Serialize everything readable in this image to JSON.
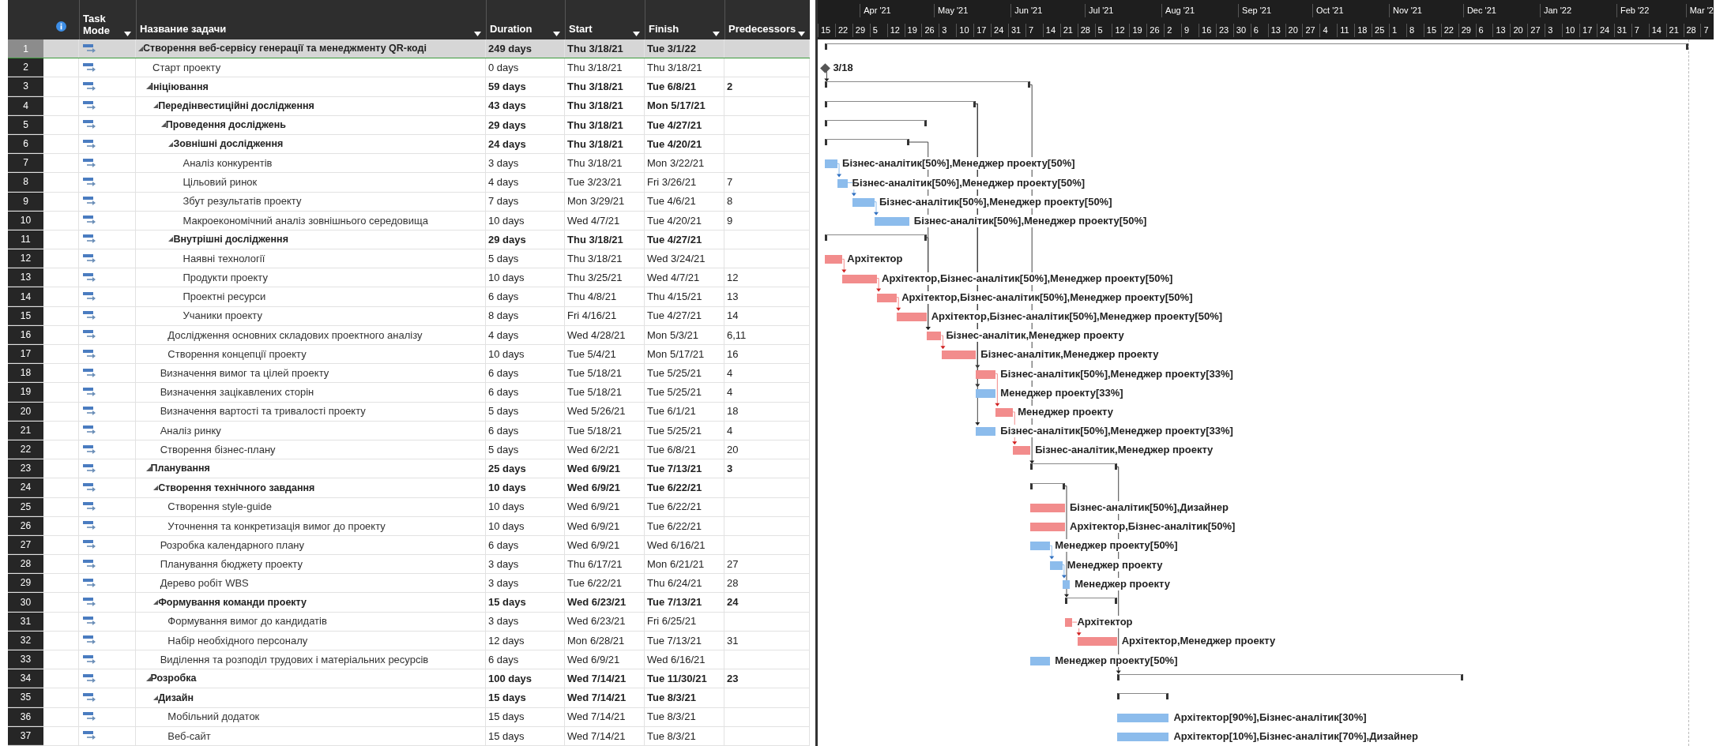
{
  "columns": [
    "Task Mode",
    "Название задачи",
    "Duration",
    "Start",
    "Finish",
    "Predecessors"
  ],
  "timescale": {
    "months": [
      "Apr '21",
      "May '21",
      "Jun '21",
      "Jul '21",
      "Aug '21",
      "Sep '21",
      "Oct '21",
      "Nov '21",
      "Dec '21",
      "Jan '22",
      "Feb '22",
      "Mar '2"
    ],
    "weeks": [
      "15",
      "22",
      "29",
      "5",
      "12",
      "19",
      "26",
      "3",
      "10",
      "17",
      "24",
      "31",
      "7",
      "14",
      "21",
      "28",
      "5",
      "12",
      "19",
      "26",
      "2",
      "9",
      "16",
      "23",
      "30",
      "6",
      "13",
      "20",
      "27",
      "4",
      "11",
      "18",
      "25",
      "1",
      "8",
      "15",
      "22",
      "29",
      "6",
      "13",
      "20",
      "27",
      "3",
      "10",
      "17",
      "24",
      "31",
      "7",
      "14",
      "21",
      "28",
      "7"
    ]
  },
  "tasks": [
    {
      "id": "1",
      "kind": "summary",
      "selected": true,
      "name": "Створення веб-сервісу генерації та менеджменту QR-коді",
      "duration": "249 days",
      "start": "Thu 3/18/21",
      "finish": "Tue 3/1/22",
      "children": [
        {
          "id": "2",
          "kind": "milestone",
          "selected": false,
          "name": "Старт проекту",
          "duration": "0 days",
          "start": "Thu 3/18/21",
          "finish": "Thu 3/18/21",
          "bar_label": "3/18"
        },
        {
          "id": "3",
          "kind": "summary",
          "selected": false,
          "name": "Ініціювання",
          "duration": "59 days",
          "start": "Thu 3/18/21",
          "finish": "Tue 6/8/21",
          "predecessors": "2",
          "children": [
            {
              "id": "4",
              "kind": "summary",
              "selected": false,
              "name": "Передінвестиційні дослідження",
              "duration": "43 days",
              "start": "Thu 3/18/21",
              "finish": "Mon 5/17/21",
              "children": [
                {
                  "id": "5",
                  "kind": "summary",
                  "selected": false,
                  "name": "Проведення досліджень",
                  "duration": "29 days",
                  "start": "Thu 3/18/21",
                  "finish": "Tue 4/27/21",
                  "children": [
                    {
                      "id": "6",
                      "kind": "summary",
                      "selected": false,
                      "name": "Зовнішні дослідження",
                      "duration": "24 days",
                      "start": "Thu 3/18/21",
                      "finish": "Tue 4/20/21",
                      "children": [
                        {
                          "id": "7",
                          "kind": "task",
                          "selected": false,
                          "name": "Аналіз конкурентів",
                          "duration": "3 days",
                          "start": "Thu 3/18/21",
                          "finish": "Mon 3/22/21",
                          "color": "#8cbcec",
                          "bar_label": "Бізнес-аналітик[50%],Менеджер проекту[50%]"
                        },
                        {
                          "id": "8",
                          "kind": "task",
                          "selected": false,
                          "name": "Цільовий ринок",
                          "duration": "4 days",
                          "start": "Tue 3/23/21",
                          "finish": "Fri 3/26/21",
                          "predecessors": "7",
                          "color": "#8cbcec",
                          "bar_label": "Бізнес-аналітик[50%],Менеджер проекту[50%]"
                        },
                        {
                          "id": "9",
                          "kind": "task",
                          "selected": false,
                          "name": "Збут результатів проекту",
                          "duration": "7 days",
                          "start": "Mon 3/29/21",
                          "finish": "Tue 4/6/21",
                          "predecessors": "8",
                          "color": "#8cbcec",
                          "bar_label": "Бізнес-аналітик[50%],Менеджер проекту[50%]"
                        },
                        {
                          "id": "10",
                          "kind": "task",
                          "selected": false,
                          "name": "Макроекономічний аналіз зовнішнього середовища",
                          "duration": "10 days",
                          "start": "Wed 4/7/21",
                          "finish": "Tue 4/20/21",
                          "predecessors": "9",
                          "color": "#8cbcec",
                          "bar_label": "Бізнес-аналітик[50%],Менеджер проекту[50%]"
                        }
                      ]
                    },
                    {
                      "id": "11",
                      "kind": "summary",
                      "selected": false,
                      "name": "Внутрішні дослідження",
                      "duration": "29 days",
                      "start": "Thu 3/18/21",
                      "finish": "Tue 4/27/21",
                      "children": [
                        {
                          "id": "12",
                          "kind": "task",
                          "selected": false,
                          "name": "Наявні технології",
                          "duration": "5 days",
                          "start": "Thu 3/18/21",
                          "finish": "Wed 3/24/21",
                          "color": "#f28c8c",
                          "bar_label": "Архітектор"
                        },
                        {
                          "id": "13",
                          "kind": "task",
                          "selected": false,
                          "name": "Продукти проекту",
                          "duration": "10 days",
                          "start": "Thu 3/25/21",
                          "finish": "Wed 4/7/21",
                          "predecessors": "12",
                          "color": "#f28c8c",
                          "bar_label": "Архітектор,Бізнес-аналітик[50%],Менеджер проекту[50%]"
                        },
                        {
                          "id": "14",
                          "kind": "task",
                          "selected": false,
                          "name": "Проектні ресурси",
                          "duration": "6 days",
                          "start": "Thu 4/8/21",
                          "finish": "Thu 4/15/21",
                          "predecessors": "13",
                          "color": "#f28c8c",
                          "bar_label": "Архітектор,Бізнес-аналітик[50%],Менеджер проекту[50%]"
                        },
                        {
                          "id": "15",
                          "kind": "task",
                          "selected": false,
                          "name": "Учаники проекту",
                          "duration": "8 days",
                          "start": "Fri 4/16/21",
                          "finish": "Tue 4/27/21",
                          "predecessors": "14",
                          "color": "#f28c8c",
                          "bar_label": "Архітектор,Бізнес-аналітик[50%],Менеджер проекту[50%]"
                        }
                      ]
                    }
                  ]
                },
                {
                  "id": "16",
                  "kind": "task",
                  "selected": false,
                  "name": "Дослідження основних складових проектного аналізу",
                  "duration": "4 days",
                  "start": "Wed 4/28/21",
                  "finish": "Mon 5/3/21",
                  "predecessors": "6,11",
                  "color": "#f28c8c",
                  "bar_label": "Бізнес-аналітик,Менеджер проекту"
                },
                {
                  "id": "17",
                  "kind": "task",
                  "selected": false,
                  "name": "Створення концепції проекту",
                  "duration": "10 days",
                  "start": "Tue 5/4/21",
                  "finish": "Mon 5/17/21",
                  "predecessors": "16",
                  "color": "#f28c8c",
                  "bar_label": "Бізнес-аналітик,Менеджер проекту"
                }
              ]
            },
            {
              "id": "18",
              "kind": "task",
              "selected": false,
              "name": "Визначення вимог та цілей проекту",
              "duration": "6 days",
              "start": "Tue 5/18/21",
              "finish": "Tue 5/25/21",
              "predecessors": "4",
              "color": "#f28c8c",
              "bar_label": "Бізнес-аналітик[50%],Менеджер проекту[33%]"
            },
            {
              "id": "19",
              "kind": "task",
              "selected": false,
              "name": "Визначення зацікавлених сторін",
              "duration": "6 days",
              "start": "Tue 5/18/21",
              "finish": "Tue 5/25/21",
              "predecessors": "4",
              "color": "#8cbcec",
              "bar_label": "Менеджер проекту[33%]"
            },
            {
              "id": "20",
              "kind": "task",
              "selected": false,
              "name": "Визначення вартості та тривалості проекту",
              "duration": "5 days",
              "start": "Wed 5/26/21",
              "finish": "Tue 6/1/21",
              "predecessors": "18",
              "color": "#f28c8c",
              "bar_label": "Менеджер проекту"
            },
            {
              "id": "21",
              "kind": "task",
              "selected": false,
              "name": "Аналіз ринку",
              "duration": "6 days",
              "start": "Tue 5/18/21",
              "finish": "Tue 5/25/21",
              "predecessors": "4",
              "color": "#8cbcec",
              "bar_label": "Бізнес-аналітик[50%],Менеджер проекту[33%]"
            },
            {
              "id": "22",
              "kind": "task",
              "selected": false,
              "name": "Створення бізнес-плану",
              "duration": "5 days",
              "start": "Wed 6/2/21",
              "finish": "Tue 6/8/21",
              "predecessors": "20",
              "color": "#f28c8c",
              "bar_label": "Бізнес-аналітик,Менеджер проекту"
            }
          ]
        },
        {
          "id": "23",
          "kind": "summary",
          "selected": false,
          "name": "Планування",
          "duration": "25 days",
          "start": "Wed 6/9/21",
          "finish": "Tue 7/13/21",
          "predecessors": "3",
          "children": [
            {
              "id": "24",
              "kind": "summary",
              "selected": false,
              "name": "Створення технічного завдання",
              "duration": "10 days",
              "start": "Wed 6/9/21",
              "finish": "Tue 6/22/21",
              "children": [
                {
                  "id": "25",
                  "kind": "task",
                  "selected": false,
                  "name": "Створення style-guide",
                  "duration": "10 days",
                  "start": "Wed 6/9/21",
                  "finish": "Tue 6/22/21",
                  "color": "#f28c8c",
                  "bar_label": "Бізнес-аналітик[50%],Дизайнер"
                },
                {
                  "id": "26",
                  "kind": "task",
                  "selected": false,
                  "name": "Уточнення та конкретизація вимог до проекту",
                  "duration": "10 days",
                  "start": "Wed 6/9/21",
                  "finish": "Tue 6/22/21",
                  "color": "#f28c8c",
                  "bar_label": "Архітектор,Бізнес-аналітик[50%]"
                }
              ]
            },
            {
              "id": "27",
              "kind": "task",
              "selected": false,
              "name": "Розробка календарного плану",
              "duration": "6 days",
              "start": "Wed 6/9/21",
              "finish": "Wed 6/16/21",
              "color": "#8cbcec",
              "bar_label": "Менеджер проекту[50%]"
            },
            {
              "id": "28",
              "kind": "task",
              "selected": false,
              "name": "Планування бюджету проекту",
              "duration": "3 days",
              "start": "Thu 6/17/21",
              "finish": "Mon 6/21/21",
              "predecessors": "27",
              "color": "#8cbcec",
              "bar_label": "Менеджер проекту"
            },
            {
              "id": "29",
              "kind": "task",
              "selected": false,
              "name": "Дерево робіт WBS",
              "duration": "3 days",
              "start": "Tue 6/22/21",
              "finish": "Thu 6/24/21",
              "predecessors": "28",
              "color": "#8cbcec",
              "bar_label": "Менеджер проекту"
            },
            {
              "id": "30",
              "kind": "summary",
              "selected": false,
              "name": "Формування команди проекту",
              "duration": "15 days",
              "start": "Wed 6/23/21",
              "finish": "Tue 7/13/21",
              "predecessors": "24",
              "children": [
                {
                  "id": "31",
                  "kind": "task",
                  "selected": false,
                  "name": "Формування вимог до кандидатів",
                  "duration": "3 days",
                  "start": "Wed 6/23/21",
                  "finish": "Fri 6/25/21",
                  "color": "#f28c8c",
                  "bar_label": "Архітектор"
                },
                {
                  "id": "32",
                  "kind": "task",
                  "selected": false,
                  "name": "Набір необхідного персоналу",
                  "duration": "12 days",
                  "start": "Mon 6/28/21",
                  "finish": "Tue 7/13/21",
                  "predecessors": "31",
                  "color": "#f28c8c",
                  "bar_label": "Архітектор,Менеджер проекту"
                }
              ]
            },
            {
              "id": "33",
              "kind": "task",
              "selected": false,
              "name": "Виділення та розподіл трудових і матеріальних ресурсів",
              "duration": "6 days",
              "start": "Wed 6/9/21",
              "finish": "Wed 6/16/21",
              "color": "#8cbcec",
              "bar_label": "Менеджер проекту[50%]"
            }
          ]
        },
        {
          "id": "34",
          "kind": "summary",
          "selected": false,
          "name": "Розробка",
          "duration": "100 days",
          "start": "Wed 7/14/21",
          "finish": "Tue 11/30/21",
          "predecessors": "23",
          "children": [
            {
              "id": "35",
              "kind": "summary",
              "selected": false,
              "name": "Дизайн",
              "duration": "15 days",
              "start": "Wed 7/14/21",
              "finish": "Tue 8/3/21",
              "children": [
                {
                  "id": "36",
                  "kind": "task",
                  "selected": false,
                  "name": "Мобільний додаток",
                  "duration": "15 days",
                  "start": "Wed 7/14/21",
                  "finish": "Tue 8/3/21",
                  "color": "#8cbcec",
                  "bar_label": "Архітектор[90%],Бізнес-аналітик[30%]"
                },
                {
                  "id": "37",
                  "kind": "task",
                  "selected": false,
                  "name": "Веб-сайт",
                  "duration": "15 days",
                  "start": "Wed 7/14/21",
                  "finish": "Tue 8/3/21",
                  "color": "#8cbcec",
                  "bar_label": "Архітектор[10%],Бізнес-аналітик[70%],Дизайнер"
                }
              ]
            }
          ]
        }
      ]
    }
  ]
}
